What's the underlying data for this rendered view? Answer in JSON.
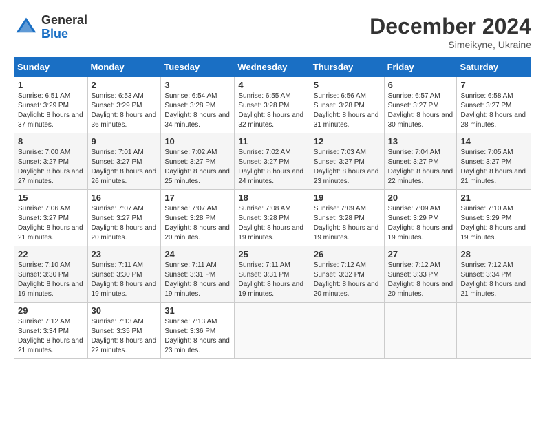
{
  "header": {
    "logo_line1": "General",
    "logo_line2": "Blue",
    "month_title": "December 2024",
    "subtitle": "Simeikyne, Ukraine"
  },
  "days_of_week": [
    "Sunday",
    "Monday",
    "Tuesday",
    "Wednesday",
    "Thursday",
    "Friday",
    "Saturday"
  ],
  "weeks": [
    [
      {
        "day": 1,
        "sunrise": "6:51 AM",
        "sunset": "3:29 PM",
        "daylight": "8 hours and 37 minutes."
      },
      {
        "day": 2,
        "sunrise": "6:53 AM",
        "sunset": "3:29 PM",
        "daylight": "8 hours and 36 minutes."
      },
      {
        "day": 3,
        "sunrise": "6:54 AM",
        "sunset": "3:28 PM",
        "daylight": "8 hours and 34 minutes."
      },
      {
        "day": 4,
        "sunrise": "6:55 AM",
        "sunset": "3:28 PM",
        "daylight": "8 hours and 32 minutes."
      },
      {
        "day": 5,
        "sunrise": "6:56 AM",
        "sunset": "3:28 PM",
        "daylight": "8 hours and 31 minutes."
      },
      {
        "day": 6,
        "sunrise": "6:57 AM",
        "sunset": "3:27 PM",
        "daylight": "8 hours and 30 minutes."
      },
      {
        "day": 7,
        "sunrise": "6:58 AM",
        "sunset": "3:27 PM",
        "daylight": "8 hours and 28 minutes."
      }
    ],
    [
      {
        "day": 8,
        "sunrise": "7:00 AM",
        "sunset": "3:27 PM",
        "daylight": "8 hours and 27 minutes."
      },
      {
        "day": 9,
        "sunrise": "7:01 AM",
        "sunset": "3:27 PM",
        "daylight": "8 hours and 26 minutes."
      },
      {
        "day": 10,
        "sunrise": "7:02 AM",
        "sunset": "3:27 PM",
        "daylight": "8 hours and 25 minutes."
      },
      {
        "day": 11,
        "sunrise": "7:02 AM",
        "sunset": "3:27 PM",
        "daylight": "8 hours and 24 minutes."
      },
      {
        "day": 12,
        "sunrise": "7:03 AM",
        "sunset": "3:27 PM",
        "daylight": "8 hours and 23 minutes."
      },
      {
        "day": 13,
        "sunrise": "7:04 AM",
        "sunset": "3:27 PM",
        "daylight": "8 hours and 22 minutes."
      },
      {
        "day": 14,
        "sunrise": "7:05 AM",
        "sunset": "3:27 PM",
        "daylight": "8 hours and 21 minutes."
      }
    ],
    [
      {
        "day": 15,
        "sunrise": "7:06 AM",
        "sunset": "3:27 PM",
        "daylight": "8 hours and 21 minutes."
      },
      {
        "day": 16,
        "sunrise": "7:07 AM",
        "sunset": "3:27 PM",
        "daylight": "8 hours and 20 minutes."
      },
      {
        "day": 17,
        "sunrise": "7:07 AM",
        "sunset": "3:28 PM",
        "daylight": "8 hours and 20 minutes."
      },
      {
        "day": 18,
        "sunrise": "7:08 AM",
        "sunset": "3:28 PM",
        "daylight": "8 hours and 19 minutes."
      },
      {
        "day": 19,
        "sunrise": "7:09 AM",
        "sunset": "3:28 PM",
        "daylight": "8 hours and 19 minutes."
      },
      {
        "day": 20,
        "sunrise": "7:09 AM",
        "sunset": "3:29 PM",
        "daylight": "8 hours and 19 minutes."
      },
      {
        "day": 21,
        "sunrise": "7:10 AM",
        "sunset": "3:29 PM",
        "daylight": "8 hours and 19 minutes."
      }
    ],
    [
      {
        "day": 22,
        "sunrise": "7:10 AM",
        "sunset": "3:30 PM",
        "daylight": "8 hours and 19 minutes."
      },
      {
        "day": 23,
        "sunrise": "7:11 AM",
        "sunset": "3:30 PM",
        "daylight": "8 hours and 19 minutes."
      },
      {
        "day": 24,
        "sunrise": "7:11 AM",
        "sunset": "3:31 PM",
        "daylight": "8 hours and 19 minutes."
      },
      {
        "day": 25,
        "sunrise": "7:11 AM",
        "sunset": "3:31 PM",
        "daylight": "8 hours and 19 minutes."
      },
      {
        "day": 26,
        "sunrise": "7:12 AM",
        "sunset": "3:32 PM",
        "daylight": "8 hours and 20 minutes."
      },
      {
        "day": 27,
        "sunrise": "7:12 AM",
        "sunset": "3:33 PM",
        "daylight": "8 hours and 20 minutes."
      },
      {
        "day": 28,
        "sunrise": "7:12 AM",
        "sunset": "3:34 PM",
        "daylight": "8 hours and 21 minutes."
      }
    ],
    [
      {
        "day": 29,
        "sunrise": "7:12 AM",
        "sunset": "3:34 PM",
        "daylight": "8 hours and 21 minutes."
      },
      {
        "day": 30,
        "sunrise": "7:13 AM",
        "sunset": "3:35 PM",
        "daylight": "8 hours and 22 minutes."
      },
      {
        "day": 31,
        "sunrise": "7:13 AM",
        "sunset": "3:36 PM",
        "daylight": "8 hours and 23 minutes."
      },
      null,
      null,
      null,
      null
    ]
  ]
}
